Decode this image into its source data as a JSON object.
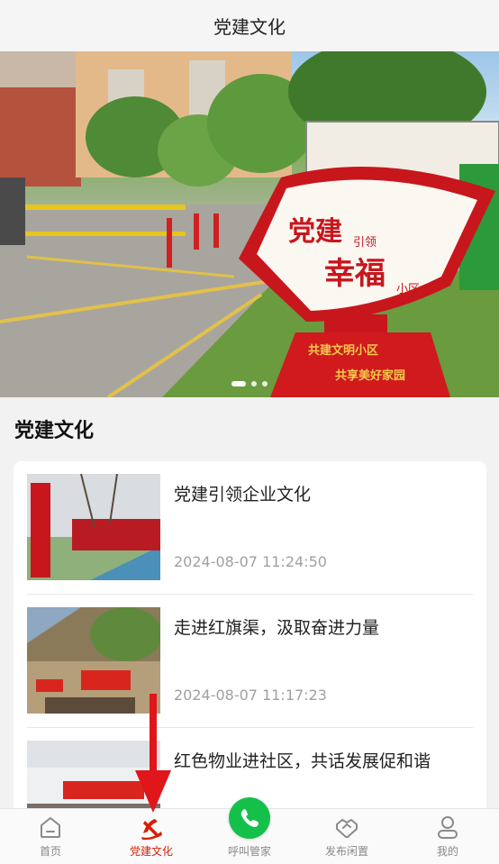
{
  "header": {
    "title": "党建文化"
  },
  "banner": {
    "sign_line1": "党建",
    "sign_line1_small": "引领",
    "sign_line2": "幸福",
    "sign_line2_small": "小区",
    "base_line1": "共建文明小区",
    "base_line2": "共享美好家园",
    "slide_count": 3,
    "active_slide": 1
  },
  "section": {
    "title": "党建文化"
  },
  "news": [
    {
      "title": "党建引领企业文化",
      "time": "2024-08-07 11:24:50"
    },
    {
      "title": "走进红旗渠，汲取奋进力量",
      "time": "2024-08-07 11:17:23"
    },
    {
      "title": "红色物业进社区，共话发展促和谐",
      "time": ""
    }
  ],
  "tabbar": {
    "items": [
      {
        "label": "首页",
        "icon": "home-icon",
        "active": false
      },
      {
        "label": "党建文化",
        "icon": "party-emblem-icon",
        "active": true
      },
      {
        "label": "呼叫管家",
        "icon": "phone-icon",
        "active": false
      },
      {
        "label": "发布闲置",
        "icon": "handshake-icon",
        "active": false
      },
      {
        "label": "我的",
        "icon": "user-icon",
        "active": false
      }
    ]
  },
  "colors": {
    "accent_red": "#d81e06",
    "call_green": "#15c04a",
    "tab_inactive": "#888888",
    "time_gray": "#a0a0a0"
  }
}
